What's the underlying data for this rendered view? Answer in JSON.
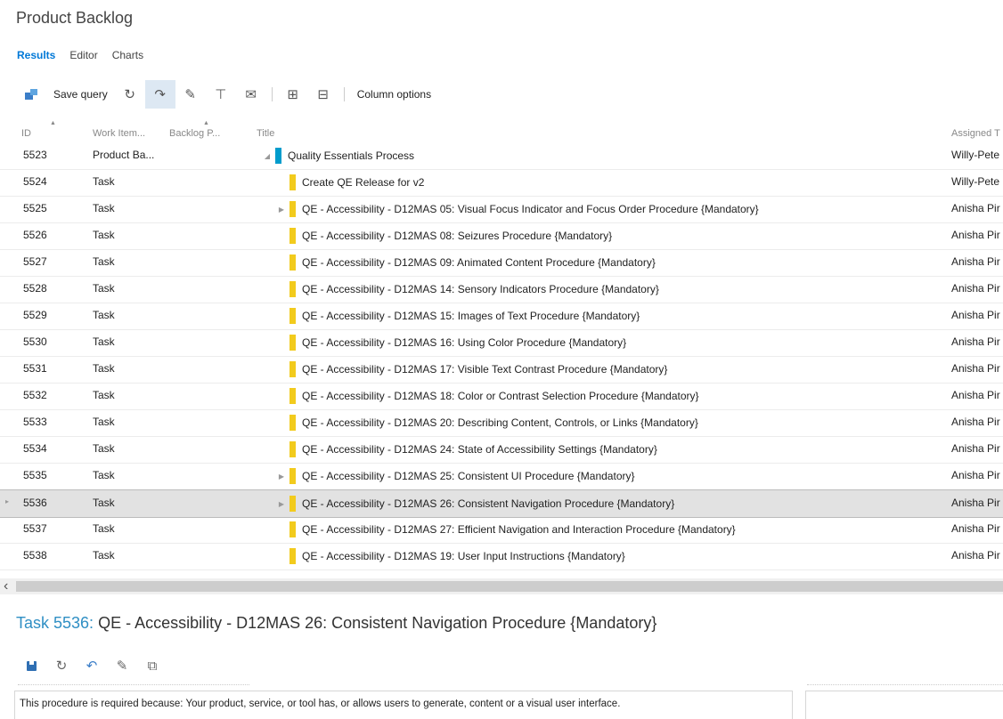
{
  "page_title": "Product Backlog",
  "tabs": [
    {
      "label": "Results",
      "active": true
    },
    {
      "label": "Editor",
      "active": false
    },
    {
      "label": "Charts",
      "active": false
    }
  ],
  "toolbar": {
    "save_query_label": "Save query",
    "column_options_label": "Column options",
    "icons": [
      "save-query-icon",
      "refresh-icon",
      "revert-icon",
      "edit-selected-icon",
      "link-items-icon",
      "email-icon",
      "expand-all-icon",
      "collapse-all-icon"
    ]
  },
  "columns": {
    "id": "ID",
    "work_item_type": "Work Item...",
    "backlog_priority": "Backlog P...",
    "title": "Title",
    "assigned_to": "Assigned T"
  },
  "rows": [
    {
      "id": "5523",
      "type": "Product Ba...",
      "title": "Quality Essentials Process",
      "assigned": "Willy-Pete",
      "color": "#009ccc",
      "level": 0,
      "expander": "expanded"
    },
    {
      "id": "5524",
      "type": "Task",
      "title": "Create QE Release for v2",
      "assigned": "Willy-Pete",
      "color": "#f2cb1d",
      "level": 1,
      "expander": "none"
    },
    {
      "id": "5525",
      "type": "Task",
      "title": "QE - Accessibility - D12MAS 05: Visual Focus Indicator and Focus Order Procedure {Mandatory}",
      "assigned": "Anisha Pir",
      "color": "#f2cb1d",
      "level": 1,
      "expander": "collapsed"
    },
    {
      "id": "5526",
      "type": "Task",
      "title": "QE - Accessibility - D12MAS 08: Seizures Procedure {Mandatory}",
      "assigned": "Anisha Pir",
      "color": "#f2cb1d",
      "level": 1,
      "expander": "none"
    },
    {
      "id": "5527",
      "type": "Task",
      "title": "QE - Accessibility - D12MAS 09: Animated Content Procedure {Mandatory}",
      "assigned": "Anisha Pir",
      "color": "#f2cb1d",
      "level": 1,
      "expander": "none"
    },
    {
      "id": "5528",
      "type": "Task",
      "title": "QE - Accessibility - D12MAS 14: Sensory Indicators Procedure {Mandatory}",
      "assigned": "Anisha Pir",
      "color": "#f2cb1d",
      "level": 1,
      "expander": "none"
    },
    {
      "id": "5529",
      "type": "Task",
      "title": "QE - Accessibility - D12MAS 15: Images of Text Procedure {Mandatory}",
      "assigned": "Anisha Pir",
      "color": "#f2cb1d",
      "level": 1,
      "expander": "none"
    },
    {
      "id": "5530",
      "type": "Task",
      "title": "QE - Accessibility - D12MAS 16: Using Color Procedure {Mandatory}",
      "assigned": "Anisha Pir",
      "color": "#f2cb1d",
      "level": 1,
      "expander": "none"
    },
    {
      "id": "5531",
      "type": "Task",
      "title": "QE - Accessibility - D12MAS 17: Visible Text Contrast Procedure {Mandatory}",
      "assigned": "Anisha Pir",
      "color": "#f2cb1d",
      "level": 1,
      "expander": "none"
    },
    {
      "id": "5532",
      "type": "Task",
      "title": "QE - Accessibility - D12MAS 18: Color or Contrast Selection Procedure {Mandatory}",
      "assigned": "Anisha Pir",
      "color": "#f2cb1d",
      "level": 1,
      "expander": "none"
    },
    {
      "id": "5533",
      "type": "Task",
      "title": "QE - Accessibility - D12MAS 20: Describing Content, Controls, or Links {Mandatory}",
      "assigned": "Anisha Pir",
      "color": "#f2cb1d",
      "level": 1,
      "expander": "none"
    },
    {
      "id": "5534",
      "type": "Task",
      "title": "QE - Accessibility - D12MAS 24: State of Accessibility Settings {Mandatory}",
      "assigned": "Anisha Pir",
      "color": "#f2cb1d",
      "level": 1,
      "expander": "none"
    },
    {
      "id": "5535",
      "type": "Task",
      "title": "QE - Accessibility - D12MAS 25: Consistent UI Procedure {Mandatory}",
      "assigned": "Anisha Pir",
      "color": "#f2cb1d",
      "level": 1,
      "expander": "collapsed"
    },
    {
      "id": "5536",
      "type": "Task",
      "title": "QE - Accessibility - D12MAS 26: Consistent Navigation Procedure {Mandatory}",
      "assigned": "Anisha Pir",
      "color": "#f2cb1d",
      "level": 1,
      "expander": "collapsed",
      "selected": true
    },
    {
      "id": "5537",
      "type": "Task",
      "title": "QE - Accessibility - D12MAS 27: Efficient Navigation and Interaction Procedure {Mandatory}",
      "assigned": "Anisha Pir",
      "color": "#f2cb1d",
      "level": 1,
      "expander": "none"
    },
    {
      "id": "5538",
      "type": "Task",
      "title": "QE - Accessibility - D12MAS 19: User Input Instructions {Mandatory}",
      "assigned": "Anisha Pir",
      "color": "#f2cb1d",
      "level": 1,
      "expander": "none"
    }
  ],
  "task_form": {
    "prefix": "Task 5536:",
    "title": "QE - Accessibility - D12MAS 26: Consistent Navigation Procedure {Mandatory}",
    "toolbar_icons": [
      "save-icon",
      "refresh-icon",
      "undo-icon",
      "edit-icon",
      "copy-icon"
    ],
    "description": "This procedure is required because: Your product, service, or tool has, or allows users to generate, content or a visual user interface."
  },
  "colors": {
    "accent": "#0078d7",
    "task_bar": "#f2cb1d",
    "pbi_bar": "#009ccc",
    "selected_row": "#e2e2e2"
  }
}
